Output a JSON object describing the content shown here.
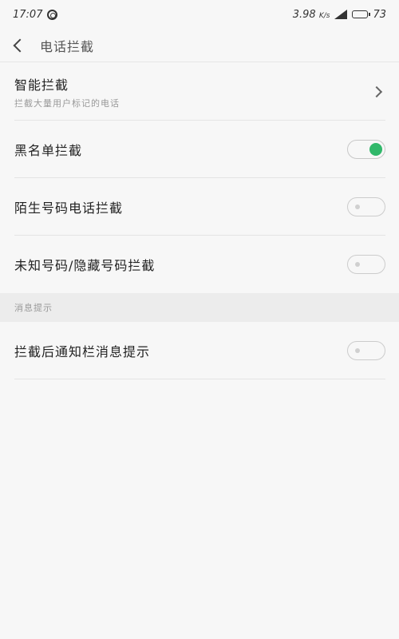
{
  "status_bar": {
    "time": "17:07",
    "speed": "3.98",
    "speed_unit": "K/s",
    "battery": "73"
  },
  "header": {
    "title": "电话拦截"
  },
  "items": [
    {
      "title": "智能拦截",
      "subtitle": "拦截大量用户标记的电话"
    },
    {
      "title": "黑名单拦截",
      "toggle_on": true
    },
    {
      "title": "陌生号码电话拦截",
      "toggle_on": false
    },
    {
      "title": "未知号码/隐藏号码拦截",
      "toggle_on": false
    }
  ],
  "section": {
    "title": "消息提示"
  },
  "notify_item": {
    "title": "拦截后通知栏消息提示",
    "toggle_on": false
  },
  "colors": {
    "toggle_on": "#31b86a",
    "background": "#f7f7f7"
  }
}
